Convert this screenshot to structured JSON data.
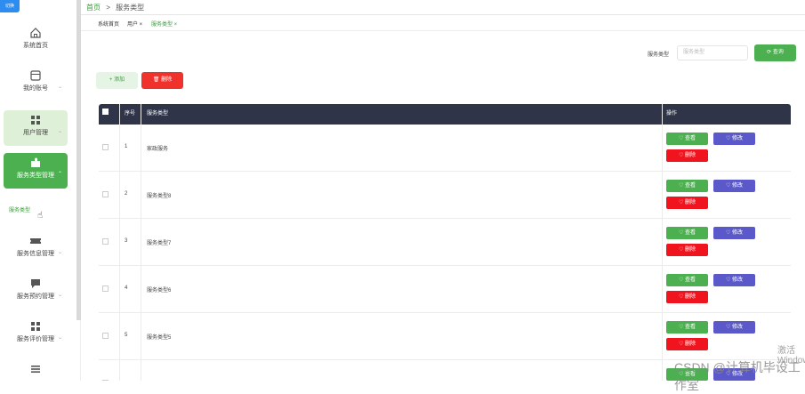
{
  "sidebar": {
    "switch_label": "切换",
    "items": [
      {
        "label": "系统首页"
      },
      {
        "label": "我的账号"
      },
      {
        "label": "用户管理"
      },
      {
        "label": "服务类型管理"
      },
      {
        "label": "服务信息管理"
      },
      {
        "label": "服务预约管理"
      },
      {
        "label": "服务评价管理"
      }
    ],
    "submenu_label": "服务类型"
  },
  "breadcrumb": {
    "home": "首页",
    "separator": ">",
    "current": "服务类型"
  },
  "tags": [
    {
      "label": "系统首页"
    },
    {
      "label": "用户 ×"
    },
    {
      "label": "服务类型 ×"
    }
  ],
  "search": {
    "label": "服务类型",
    "placeholder": "服务类型",
    "button": "查询"
  },
  "actions": {
    "add": "添加",
    "delete": "删除"
  },
  "table": {
    "headers": {
      "index": "序号",
      "type": "服务类型",
      "ops": "操作"
    },
    "rows": [
      {
        "index": "1",
        "type": "家政服务"
      },
      {
        "index": "2",
        "type": "服务类型8"
      },
      {
        "index": "3",
        "type": "服务类型7"
      },
      {
        "index": "4",
        "type": "服务类型6"
      },
      {
        "index": "5",
        "type": "服务类型5"
      }
    ],
    "row_buttons": {
      "view": "查看",
      "edit": "修改",
      "delete": "删除"
    }
  },
  "watermarks": {
    "windows": "激活 Windows",
    "csdn": "CSDN @计算机毕设工作室"
  },
  "colors": {
    "primary": "#4caf50",
    "header": "#2f3449",
    "danger": "#f0141e",
    "edit": "#5b59c9"
  }
}
